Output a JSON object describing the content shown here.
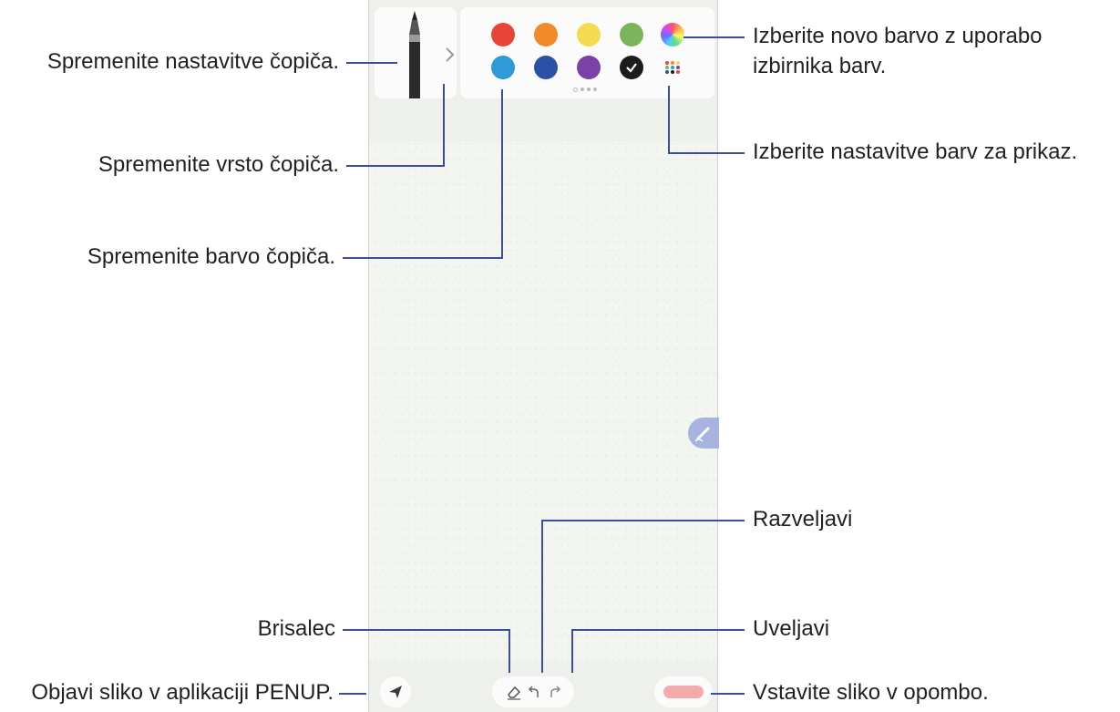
{
  "labels": {
    "brush_settings": "Spremenite nastavitve čopiča.",
    "brush_type": "Spremenite vrsto čopiča.",
    "brush_color": "Spremenite barvo čopiča.",
    "eraser": "Brisalec",
    "share_penup": "Objavi sliko v aplikaciji PENUP.",
    "color_picker_line1": "Izberite novo barvo z uporabo",
    "color_picker_line2": "izbirnika barv.",
    "color_settings": "Izberite nastavitve barv za prikaz.",
    "undo": "Razveljavi",
    "redo": "Uveljavi",
    "insert_image": "Vstavite sliko v opombo."
  },
  "palette": {
    "colors": [
      "#e8443a",
      "#f28a2c",
      "#f5db4f",
      "#7bb55b",
      "#2e9ad6",
      "#2a51a3",
      "#7a41a6",
      "#1c1c1c"
    ],
    "selected_index": 7,
    "page_count": 4,
    "current_page": 0
  },
  "icons": {
    "expand": "chevron-right-icon",
    "color_picker": "color-wheel-icon",
    "color_settings": "grid-dots-icon",
    "eraser": "eraser-icon",
    "undo": "undo-icon",
    "redo": "redo-icon",
    "share": "send-icon",
    "pen": "pen-icon",
    "selected": "check-icon"
  },
  "colors": {
    "callout_line": "#3c4d9c",
    "insert_button": "#f4a9aa"
  }
}
